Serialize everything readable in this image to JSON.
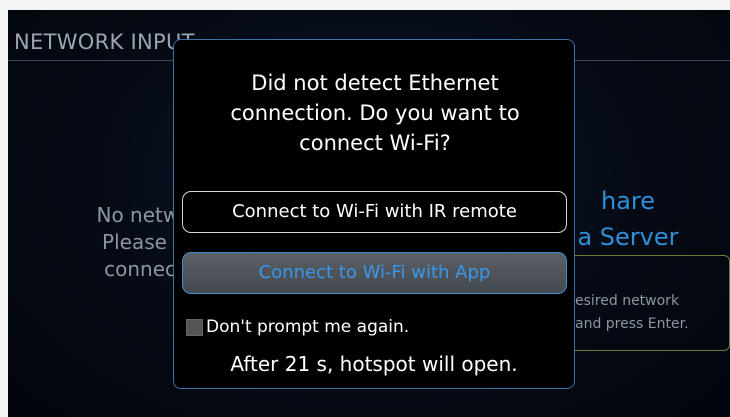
{
  "screen": {
    "title": "NETWORK INPUT",
    "left_text": "No netwo\nPlease b\nconnect",
    "right_heading": "hare\na Server",
    "right_box_text": "esired network\nand press Enter."
  },
  "dialog": {
    "message": "Did not detect Ethernet connection. Do you want to connect Wi-Fi?",
    "buttons": {
      "ir_remote": "Connect to Wi-Fi with IR remote",
      "app": "Connect to Wi-Fi with App"
    },
    "checkbox": {
      "label": "Don't prompt me again.",
      "checked": false
    },
    "countdown": "After 21 s, hotspot will open."
  },
  "colors": {
    "accent_blue": "#3a98e8",
    "dialog_border": "#3a6fa8",
    "background": "#050a14"
  }
}
